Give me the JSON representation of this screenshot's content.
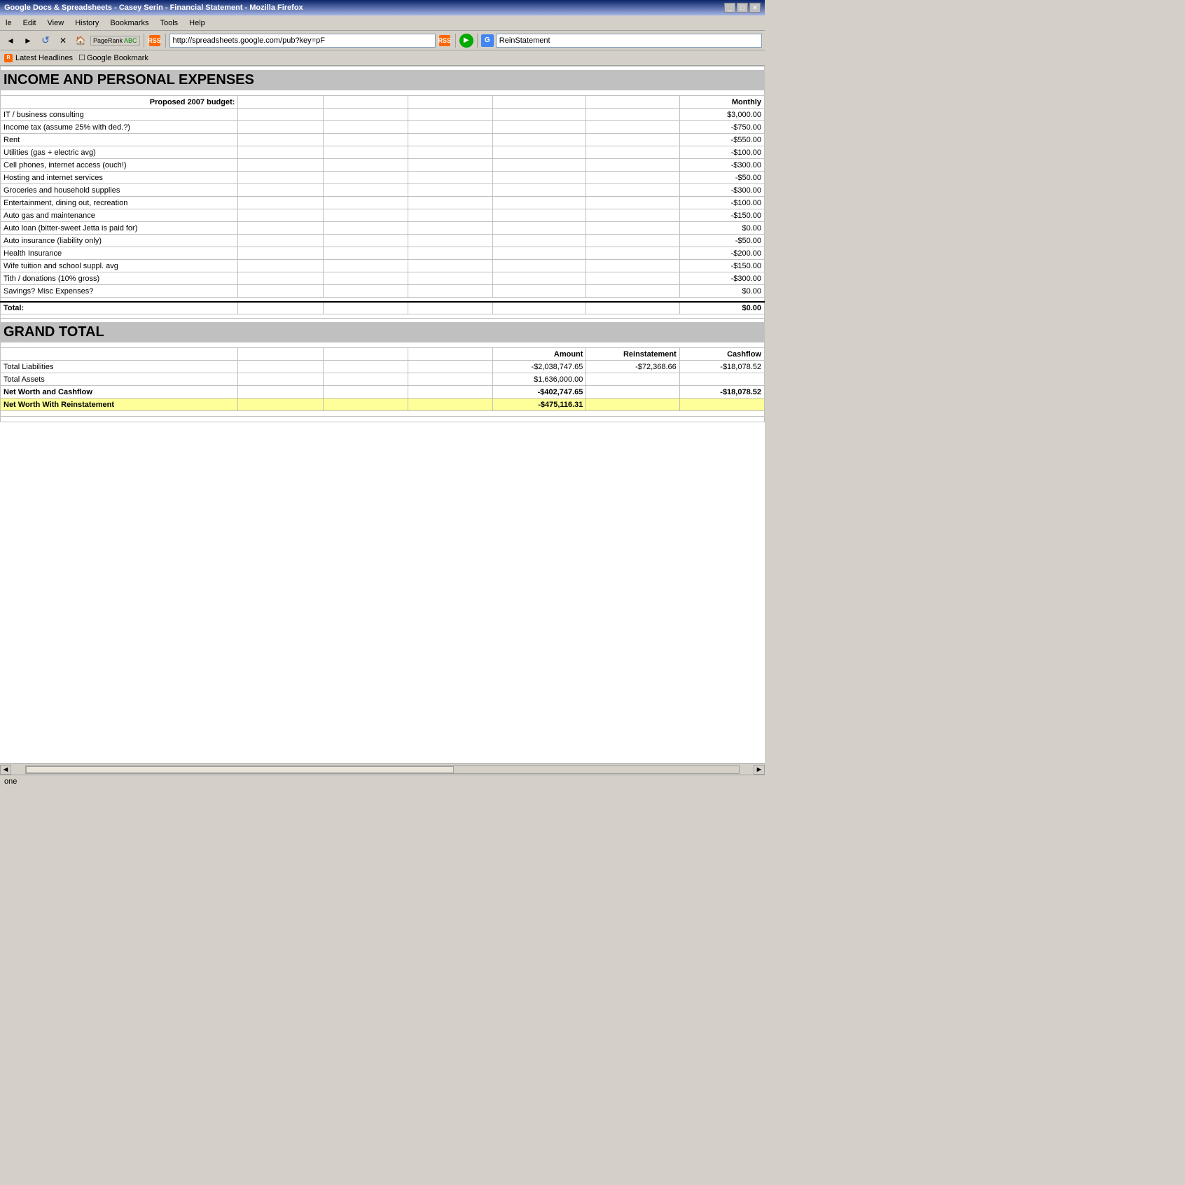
{
  "titlebar": {
    "text": "Google Docs & Spreadsheets - Casey Serin - Financial Statement - Mozilla Firefox",
    "buttons": [
      "_",
      "[]",
      "X"
    ]
  },
  "menubar": {
    "items": [
      "le",
      "Edit",
      "View",
      "History",
      "Bookmarks",
      "Tools",
      "Help"
    ]
  },
  "toolbar": {
    "address": "http://spreadsheets.google.com/pub?key=pF",
    "search_placeholder": "ReinStatement"
  },
  "bookmarks": {
    "items": [
      "Latest Headlines",
      "Google Bookmark"
    ]
  },
  "spreadsheet": {
    "income_section": {
      "title": "INCOME AND PERSONAL EXPENSES",
      "header_col": "Monthly",
      "budget_label": "Proposed 2007 budget:",
      "rows": [
        {
          "label": "IT / business consulting",
          "monthly": "$3,000.00"
        },
        {
          "label": "Income tax (assume 25% with ded.?)",
          "monthly": "-$750.00"
        },
        {
          "label": "Rent",
          "monthly": "-$550.00"
        },
        {
          "label": "Utilities (gas + electric avg)",
          "monthly": "-$100.00"
        },
        {
          "label": "Cell phones, internet access (ouch!)",
          "monthly": "-$300.00"
        },
        {
          "label": "Hosting and internet services",
          "monthly": "-$50.00"
        },
        {
          "label": "Groceries and household supplies",
          "monthly": "-$300.00"
        },
        {
          "label": "Entertainment, dining out, recreation",
          "monthly": "-$100.00"
        },
        {
          "label": "Auto gas and maintenance",
          "monthly": "-$150.00"
        },
        {
          "label": "Auto loan (bitter-sweet Jetta is paid for)",
          "monthly": "$0.00"
        },
        {
          "label": "Auto insurance (liability only)",
          "monthly": "-$50.00"
        },
        {
          "label": "Health Insurance",
          "monthly": "-$200.00"
        },
        {
          "label": "Wife tuition and school suppl. avg",
          "monthly": "-$150.00"
        },
        {
          "label": "Tith / donations (10% gross)",
          "monthly": "-$300.00"
        },
        {
          "label": "Savings? Misc Expenses?",
          "monthly": "$0.00"
        }
      ],
      "total_label": "Total:",
      "total_value": "$0.00"
    },
    "grand_total": {
      "title": "GRAND TOTAL",
      "col_amount": "Amount",
      "col_reinstatement": "Reinstatement",
      "col_cashflow": "Cashflow",
      "rows": [
        {
          "label": "Total Liabilities",
          "amount": "-$2,038,747.65",
          "reinstatement": "-$72,368.66",
          "cashflow": "-$18,078.52",
          "bold": false,
          "yellow": false
        },
        {
          "label": "Total Assets",
          "amount": "$1,636,000.00",
          "reinstatement": "",
          "cashflow": "",
          "bold": false,
          "yellow": false
        },
        {
          "label": "Net Worth and Cashflow",
          "amount": "-$402,747.65",
          "reinstatement": "",
          "cashflow": "-$18,078.52",
          "bold": true,
          "yellow": false
        },
        {
          "label": "Net Worth With Reinstatement",
          "amount": "-$475,116.31",
          "reinstatement": "",
          "cashflow": "",
          "bold": true,
          "yellow": true
        }
      ]
    }
  },
  "statusbar": {
    "text": "one"
  }
}
